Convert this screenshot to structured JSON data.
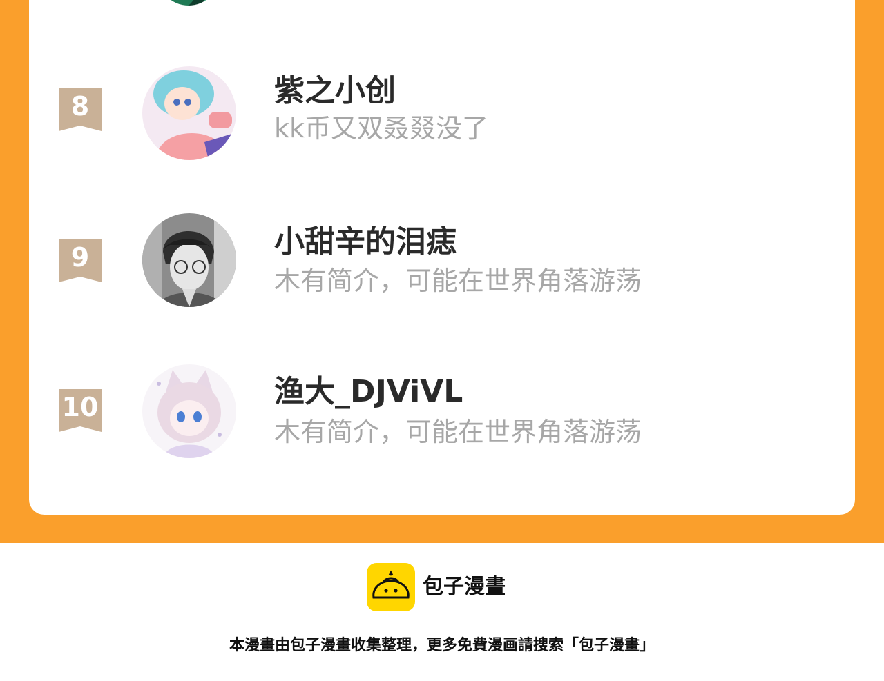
{
  "ranking": {
    "items": [
      {
        "rank": "8",
        "name": "紫之小创",
        "bio": "kk币又双叒叕没了",
        "avatar_icon": "anime-girl-avatar"
      },
      {
        "rank": "9",
        "name": "小甜辛的泪痣",
        "bio": "木有简介，可能在世界角落游荡",
        "avatar_icon": "manga-boy-avatar"
      },
      {
        "rank": "10",
        "name": "渔大_DJViVL",
        "bio": "木有简介，可能在世界角落游荡",
        "avatar_icon": "cat-girl-avatar"
      }
    ]
  },
  "footer": {
    "logo_icon": "bun-logo-icon",
    "brand": "包子漫畫",
    "note": "本漫畫由包子漫畫收集整理，更多免費漫画請搜索「包子漫畫」"
  },
  "colors": {
    "background_orange": "#fa9f2c",
    "badge_tan": "#c9b197",
    "name_text": "#2a2a2a",
    "bio_text": "#a7a7a7",
    "logo_yellow": "#ffd600"
  }
}
